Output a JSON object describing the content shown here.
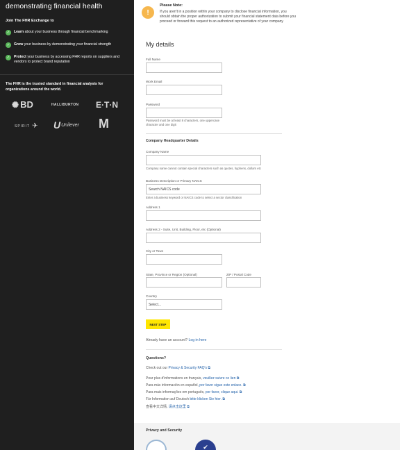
{
  "left": {
    "headline": "demonstrating financial health",
    "join": "Join The FHR Exchange to",
    "benefits": [
      {
        "bold": "Learn",
        "rest": " about your business through financial benchmarking"
      },
      {
        "bold": "Grow",
        "rest": " your business by demonstrating your financial strength"
      },
      {
        "bold": "Protect",
        "rest": " your business by accessing FHR reports on suppliers and vendors to protect brand reputation"
      }
    ],
    "trusted": "The FHR is the trusted standard in financial analysis for organizations around the world.",
    "logos": [
      "BD",
      "HALLIBURTON",
      "E·T·N",
      "SPIRIT",
      "Unilever",
      "McDonald's"
    ]
  },
  "note": {
    "icon": "!",
    "title": "Please Note:",
    "body": "If you aren't in a position within your company to disclose financial information, you should obtain the proper authorization to submit your financial statement data before you proceed or forward this request to an authorized representative of your company"
  },
  "form": {
    "heading": "My details",
    "full_name_label": "Full Name",
    "work_email_label": "Work Email",
    "password_label": "Password",
    "password_hint": "Password must be at least 8 characters, one uppercase character and one digit",
    "company_heading": "Company Headquarter Details",
    "company_name_label": "Company Name",
    "company_name_hint": "Company name cannot contain special characters such as quotes, hyphens, dollars etc",
    "naics_label": "Business Description or Primary NAICS",
    "naics_placeholder": "Search NAICS code",
    "naics_hint": "Enter a business keyword or NAICS code to select a sector classification",
    "address1_label": "Address 1",
    "address2_label": "Address 2 - Suite, Unit, Building, Floor, etc (Optional)",
    "city_label": "City or Town",
    "state_label": "State, Province or Region (Optional)",
    "zip_label": "ZIP / Postal Code",
    "country_label": "Country",
    "country_value": "Select...",
    "next_label": "NEXT STEP",
    "account_text": "Already have an account?",
    "login_label": "Log in here"
  },
  "questions": {
    "heading": "Questions?",
    "faq_prefix": "Check out our",
    "faq_link": "Privacy & Security FAQ's",
    "lang": [
      {
        "text": "Pour plus d'informations en français,",
        "link": "veuillez suivre ce lien"
      },
      {
        "text": "Para más información en español,",
        "link": "por favor sigue este enlace."
      },
      {
        "text": "Para mais informações em português,",
        "link": "por favor, clique aqui."
      },
      {
        "text": "Für Information auf Deutsch",
        "link": "bitte klicken Sie hier."
      },
      {
        "text": "查看中文详情,",
        "link": "请点击这里"
      }
    ]
  },
  "privacy": {
    "title": "Privacy and Security"
  },
  "colors": {
    "accent_yellow": "#ffe600",
    "check_green": "#5cb85c",
    "note_orange": "#f6b74e",
    "link_blue": "#1f5fa8",
    "panel_dark": "#1f1f1f"
  }
}
